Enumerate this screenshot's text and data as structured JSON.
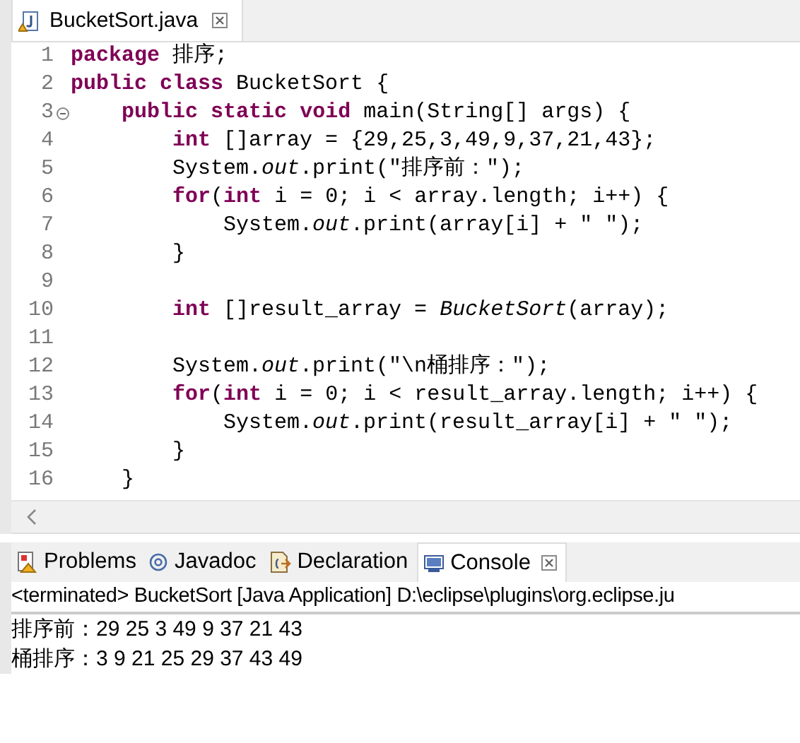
{
  "editor_tab": {
    "title": "BucketSort.java",
    "selected": true
  },
  "code_lines": [
    {
      "number": "1",
      "fold_marker": false,
      "text": "**package** 排序;"
    },
    {
      "number": "2",
      "fold_marker": false,
      "text": "**public** **class** BucketSort {"
    },
    {
      "number": "3",
      "fold_marker": true,
      "text": "    **public** **static** **void** main(String[] args) {"
    },
    {
      "number": "4",
      "fold_marker": false,
      "text": "        **int** []array = {29,25,3,49,9,37,21,43};"
    },
    {
      "number": "5",
      "fold_marker": false,
      "text": "        System.*out*.print(\"排序前：\");"
    },
    {
      "number": "6",
      "fold_marker": false,
      "text": "        **for**(**int** i = 0; i < array.length; i++) {"
    },
    {
      "number": "7",
      "fold_marker": false,
      "text": "            System.*out*.print(array[i] + \" \");"
    },
    {
      "number": "8",
      "fold_marker": false,
      "text": "        }"
    },
    {
      "number": "9",
      "fold_marker": false
    },
    {
      "number": "10",
      "fold_marker": false,
      "text": "        **int** []result_array = *BucketSort*(array);"
    },
    {
      "number": "11",
      "fold_marker": false
    },
    {
      "number": "12",
      "fold_marker": false,
      "text": "        System.*out*.print(\"\\n桶排序：\");"
    },
    {
      "number": "13",
      "fold_marker": false,
      "text": "        **for**(**int** i = 0; i < result_array.length; i++) {"
    },
    {
      "number": "14",
      "fold_marker": false,
      "text": "            System.*out*.print(result_array[i] + \" \");"
    },
    {
      "number": "15",
      "fold_marker": false,
      "text": "        }"
    },
    {
      "number": "16",
      "fold_marker": false,
      "text": "    }"
    }
  ],
  "panel_tabs": [
    {
      "label": "Problems",
      "kind": "problems",
      "selected": false
    },
    {
      "label": "Javadoc",
      "kind": "javadoc",
      "selected": false
    },
    {
      "label": "Declaration",
      "kind": "declaration",
      "selected": false
    },
    {
      "label": "Console",
      "kind": "console",
      "selected": true
    }
  ],
  "console": {
    "header": "<terminated> BucketSort [Java Application] D:\\eclipse\\plugins\\org.eclipse.ju",
    "output": [
      "排序前：29 25 3 49 9 37 21 43",
      "桶排序：3 9 21 25 29 37 43 49"
    ]
  }
}
